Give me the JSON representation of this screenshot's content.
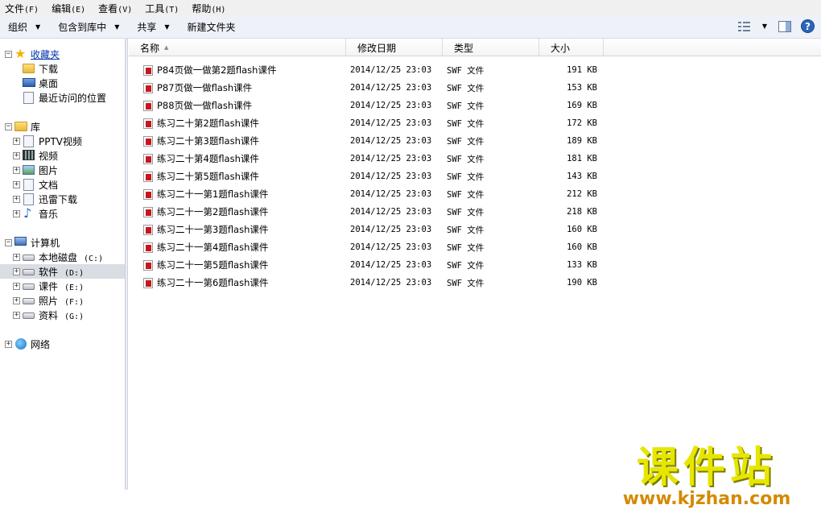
{
  "menubar": [
    {
      "label": "文件",
      "accel": "(F)"
    },
    {
      "label": "编辑",
      "accel": "(E)"
    },
    {
      "label": "查看",
      "accel": "(V)"
    },
    {
      "label": "工具",
      "accel": "(T)"
    },
    {
      "label": "帮助",
      "accel": "(H)"
    }
  ],
  "toolbar": {
    "organize": "组织",
    "include_library": "包含到库中",
    "share": "共享",
    "new_folder": "新建文件夹",
    "help_glyph": "?"
  },
  "nav": {
    "favorites": {
      "label": "收藏夹",
      "items": [
        "下载",
        "桌面",
        "最近访问的位置"
      ]
    },
    "libraries": {
      "label": "库",
      "items": [
        "PPTV视频",
        "视频",
        "图片",
        "文档",
        "迅雷下载",
        "音乐"
      ]
    },
    "computer": {
      "label": "计算机",
      "drives": [
        {
          "label": "本地磁盘",
          "letter": "(C:)"
        },
        {
          "label": "软件",
          "letter": "(D:)",
          "selected": true
        },
        {
          "label": "课件",
          "letter": "(E:)"
        },
        {
          "label": "照片",
          "letter": "(F:)"
        },
        {
          "label": "资料",
          "letter": "(G:)"
        }
      ]
    },
    "network": {
      "label": "网络"
    }
  },
  "columns": {
    "name": "名称",
    "date": "修改日期",
    "type": "类型",
    "size": "大小"
  },
  "files": [
    {
      "name": "P84页做一做第2题flash课件",
      "date": "2014/12/25 23:03",
      "type": "SWF 文件",
      "size": "191 KB"
    },
    {
      "name": "P87页做一做flash课件",
      "date": "2014/12/25 23:03",
      "type": "SWF 文件",
      "size": "153 KB"
    },
    {
      "name": "P88页做一做flash课件",
      "date": "2014/12/25 23:03",
      "type": "SWF 文件",
      "size": "169 KB"
    },
    {
      "name": "练习二十第2题flash课件",
      "date": "2014/12/25 23:03",
      "type": "SWF 文件",
      "size": "172 KB"
    },
    {
      "name": "练习二十第3题flash课件",
      "date": "2014/12/25 23:03",
      "type": "SWF 文件",
      "size": "189 KB"
    },
    {
      "name": "练习二十第4题flash课件",
      "date": "2014/12/25 23:03",
      "type": "SWF 文件",
      "size": "181 KB"
    },
    {
      "name": "练习二十第5题flash课件",
      "date": "2014/12/25 23:03",
      "type": "SWF 文件",
      "size": "143 KB"
    },
    {
      "name": "练习二十一第1题flash课件",
      "date": "2014/12/25 23:03",
      "type": "SWF 文件",
      "size": "212 KB"
    },
    {
      "name": "练习二十一第2题flash课件",
      "date": "2014/12/25 23:03",
      "type": "SWF 文件",
      "size": "218 KB"
    },
    {
      "name": "练习二十一第3题flash课件",
      "date": "2014/12/25 23:03",
      "type": "SWF 文件",
      "size": "160 KB"
    },
    {
      "name": "练习二十一第4题flash课件",
      "date": "2014/12/25 23:03",
      "type": "SWF 文件",
      "size": "160 KB"
    },
    {
      "name": "练习二十一第5题flash课件",
      "date": "2014/12/25 23:03",
      "type": "SWF 文件",
      "size": "133 KB"
    },
    {
      "name": "练习二十一第6题flash课件",
      "date": "2014/12/25 23:03",
      "type": "SWF 文件",
      "size": "190 KB"
    }
  ],
  "watermark": {
    "title": "课件站",
    "url": "www.kjzhan.com"
  }
}
